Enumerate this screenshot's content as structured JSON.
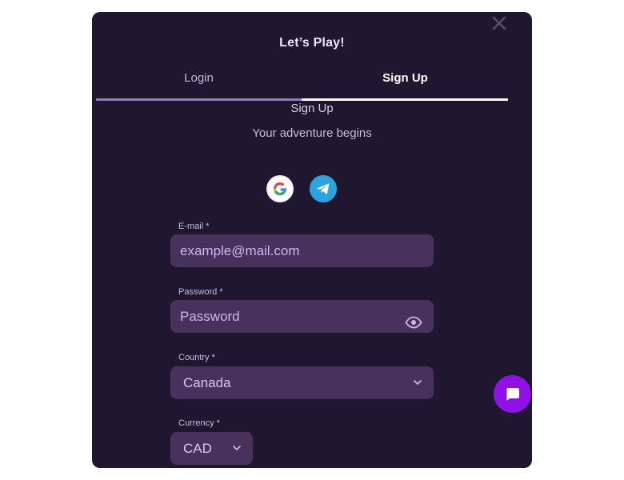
{
  "modal": {
    "title": "Let’s Play!",
    "close_icon": "close-icon"
  },
  "tabs": [
    {
      "label": "Login",
      "active": false
    },
    {
      "label": "Sign Up",
      "active": true
    }
  ],
  "signup": {
    "heading": "Sign Up",
    "tagline": "Your adventure begins"
  },
  "social": {
    "google_icon": "google-icon",
    "telegram_icon": "telegram-icon"
  },
  "form": {
    "email": {
      "label": "E-mail *",
      "placeholder": "example@mail.com",
      "value": ""
    },
    "password": {
      "label": "Password *",
      "placeholder": "Password",
      "value": "",
      "toggle_icon": "eye-icon"
    },
    "country": {
      "label": "Country *",
      "value": "Canada",
      "icon": "chevron-down-icon"
    },
    "currency": {
      "label": "Currency *",
      "value": "CAD",
      "icon": "chevron-down-icon"
    }
  },
  "chat": {
    "icon": "chat-bubble-icon"
  },
  "colors": {
    "modal_bg": "#1f1630",
    "input_bg": "#47325e",
    "accent": "#8f11e8",
    "tab_indicator": "#8f7ac8"
  }
}
